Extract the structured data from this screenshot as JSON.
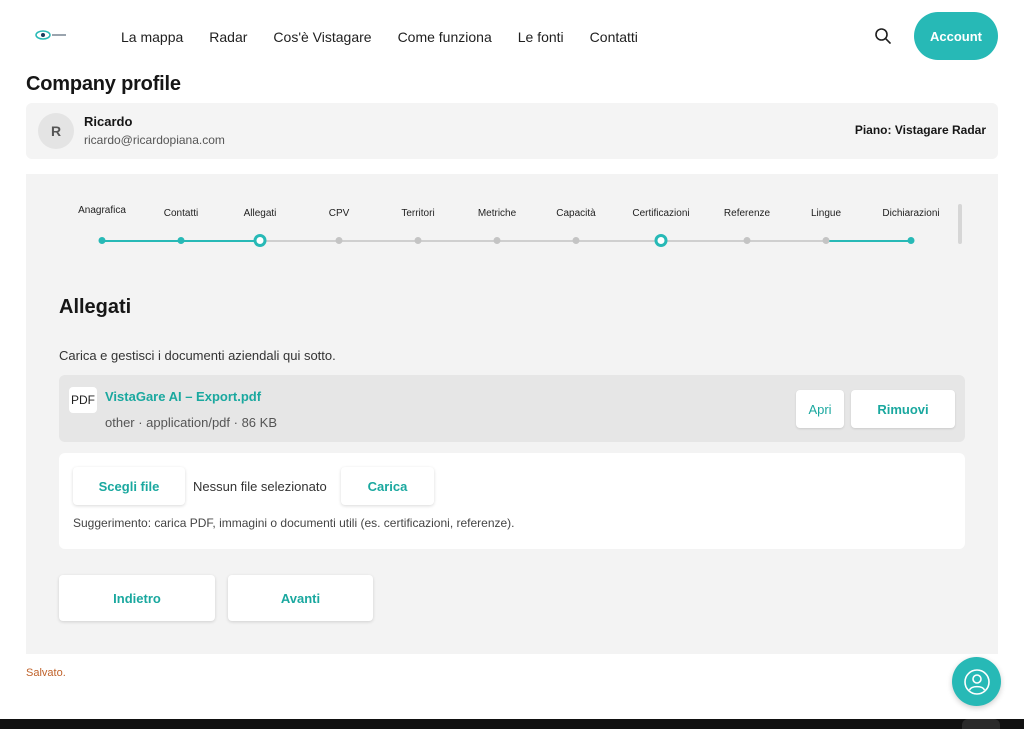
{
  "nav": {
    "links": [
      "La mappa",
      "Radar",
      "Cos'è Vistagare",
      "Come funziona",
      "Le fonti",
      "Contatti"
    ],
    "account_label": "Account"
  },
  "page_title": "Company profile",
  "user": {
    "initial": "R",
    "name": "Ricardo",
    "email": "ricardo@ricardopiana.com",
    "plan": "Piano: Vistagare Radar"
  },
  "steps": [
    {
      "label": "Anagrafica",
      "state": "done"
    },
    {
      "label": "Contatti",
      "state": "done"
    },
    {
      "label": "Allegati",
      "state": "current"
    },
    {
      "label": "CPV",
      "state": "todo"
    },
    {
      "label": "Territori",
      "state": "todo"
    },
    {
      "label": "Metriche",
      "state": "todo"
    },
    {
      "label": "Capacità",
      "state": "todo"
    },
    {
      "label": "Certificazioni",
      "state": "current"
    },
    {
      "label": "Referenze",
      "state": "todo"
    },
    {
      "label": "Lingue",
      "state": "todo"
    },
    {
      "label": "Dichiarazioni",
      "state": "done"
    }
  ],
  "section": {
    "title": "Allegati",
    "description": "Carica e gestisci i documenti aziendali qui sotto."
  },
  "file": {
    "icon_label": "PDF",
    "name": "VistaGare AI – Export.pdf",
    "meta": "other · application/pdf · 86 KB",
    "open_label": "Apri",
    "remove_label": "Rimuovi"
  },
  "upload": {
    "choose_label": "Scegli file",
    "no_file": "Nessun file selezionato",
    "upload_label": "Carica",
    "hint": "Suggerimento: carica PDF, immagini o documenti utili (es. certificazioni, referenze)."
  },
  "actions": {
    "back_label": "Indietro",
    "next_label": "Avanti"
  },
  "status": "Salvato.",
  "colors": {
    "accent": "#27b9b6",
    "accent_text": "#1aa89f",
    "saved_text": "#c0622a"
  }
}
